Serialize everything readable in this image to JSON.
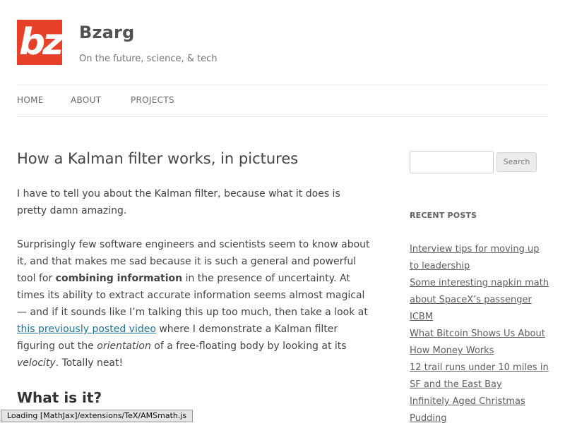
{
  "site": {
    "logo_text": "bz",
    "title": "Bzarg",
    "description": "On the future, science, & tech"
  },
  "nav": {
    "home": "HOME",
    "about": "ABOUT",
    "projects": "PROJECTS"
  },
  "post": {
    "title": "How a Kalman filter works, in pictures",
    "p1": "I have to tell you about the Kalman filter, because what it does is pretty damn amazing.",
    "p2_a": "Surprisingly few software engineers and scientists seem to know about it, and that makes me sad because it is such a general and powerful tool for ",
    "p2_bold": "combining information",
    "p2_b": " in the presence of uncertainty. At times its ability to extract accurate information seems almost magical— and if it sounds like I’m talking this up too much, then take a look at ",
    "p2_link": "this previously posted video",
    "p2_c": " where I demonstrate a Kalman filter figuring out the ",
    "p2_em1": "orientation",
    "p2_d": " of a free-floating body by looking at its ",
    "p2_em2": "velocity",
    "p2_e": ". Totally neat!",
    "h2": "What is it?"
  },
  "sidebar": {
    "search_placeholder": "",
    "search_button": "Search",
    "recent_title": "RECENT POSTS",
    "recent_posts": [
      "Interview tips for moving up to leadership",
      "Some interesting napkin math about SpaceX’s passenger ICBM",
      "What Bitcoin Shows Us About How Money Works",
      "12 trail runs under 10 miles in SF and the East Bay",
      "Infinitely Aged Christmas Pudding"
    ]
  },
  "status": {
    "loading": "Loading [MathJax]/extensions/TeX/AMSmath.js"
  }
}
